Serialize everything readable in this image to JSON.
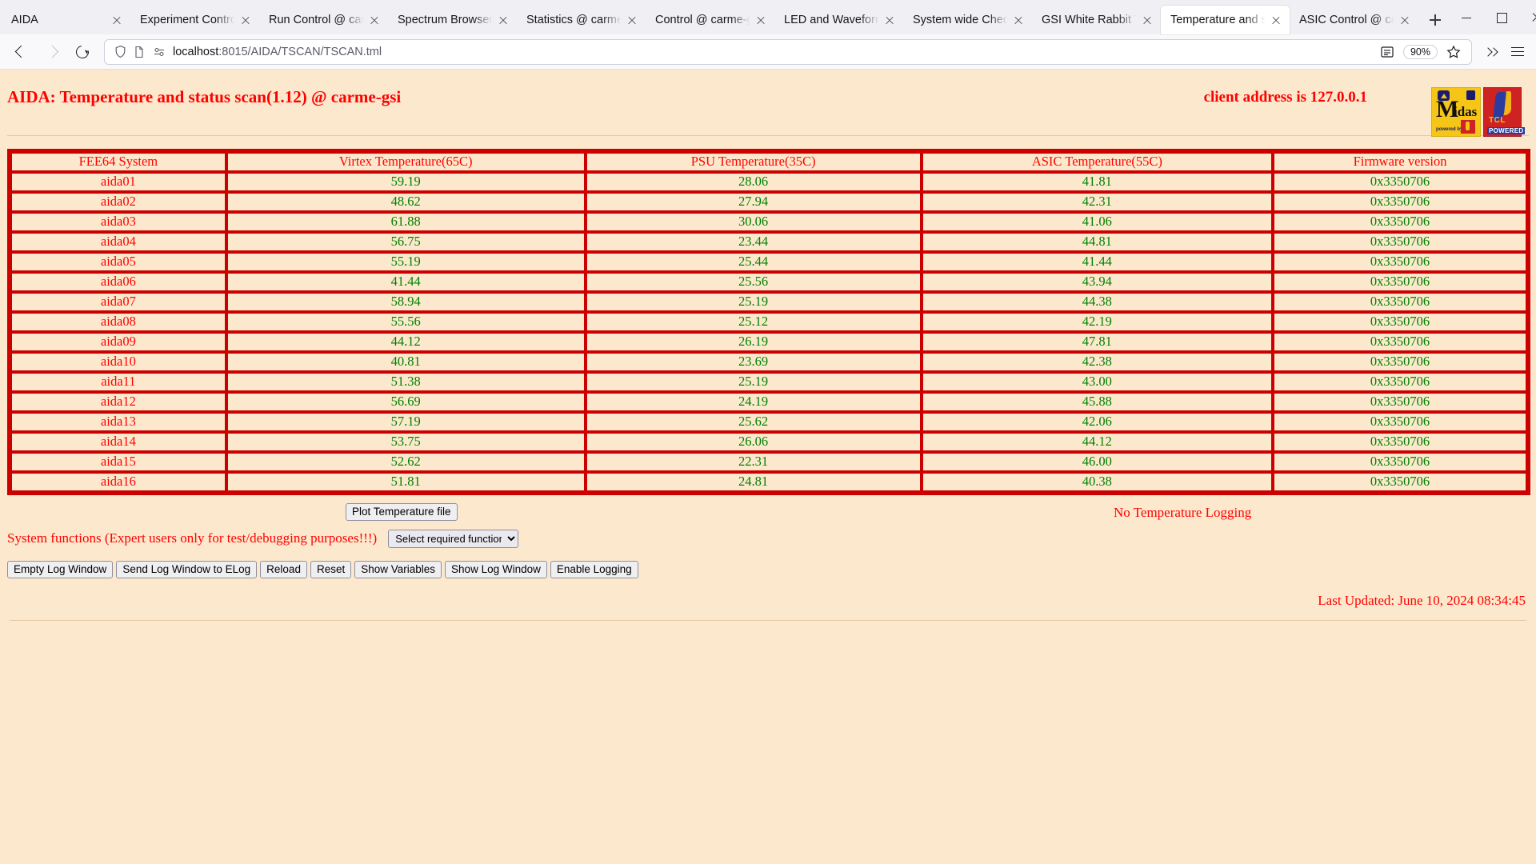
{
  "browser": {
    "tabs": [
      {
        "label": "AIDA",
        "active": false
      },
      {
        "label": "Experiment Control",
        "active": false
      },
      {
        "label": "Run Control @ carme",
        "active": false
      },
      {
        "label": "Spectrum Browser",
        "active": false
      },
      {
        "label": "Statistics @ carme",
        "active": false
      },
      {
        "label": "Control @ carme-gsi",
        "active": false
      },
      {
        "label": "LED and Waveform",
        "active": false
      },
      {
        "label": "System wide Check",
        "active": false
      },
      {
        "label": "GSI White Rabbit Ti",
        "active": false
      },
      {
        "label": "Temperature and st",
        "active": true
      },
      {
        "label": "ASIC Control @ car",
        "active": false
      }
    ],
    "new_tab_icon": "plus-icon",
    "window_controls": [
      "minimize-icon",
      "maximize-icon",
      "close-icon"
    ],
    "nav": {
      "back_icon": "arrow-left-icon",
      "forward_icon": "arrow-right-icon",
      "reload_icon": "reload-icon",
      "shield_icon": "shield-icon",
      "page_icon": "page-icon",
      "permissions_icon": "permissions-icon",
      "reader_icon": "reader-view-icon",
      "star_icon": "bookmark-star-icon",
      "overflow_icon": "chevron-double-right-icon",
      "menu_icon": "hamburger-menu-icon"
    },
    "url_host": "localhost",
    "url_path": ":8015/AIDA/TSCAN/TSCAN.tml",
    "zoom_level": "90%"
  },
  "page": {
    "title": "AIDA: Temperature and status scan(1.12) @ carme-gsi",
    "client_address": "client address is 127.0.0.1",
    "logos": {
      "midas": {
        "letter": "M",
        "rest": "idas",
        "powered_by": "powered by"
      },
      "tcl": {
        "name": "TCL",
        "powered": "POWERED"
      }
    },
    "table": {
      "columns": [
        "FEE64 System",
        "Virtex Temperature(65C)",
        "PSU Temperature(35C)",
        "ASIC Temperature(55C)",
        "Firmware version"
      ],
      "rows": [
        [
          "aida01",
          "59.19",
          "28.06",
          "41.81",
          "0x3350706"
        ],
        [
          "aida02",
          "48.62",
          "27.94",
          "42.31",
          "0x3350706"
        ],
        [
          "aida03",
          "61.88",
          "30.06",
          "41.06",
          "0x3350706"
        ],
        [
          "aida04",
          "56.75",
          "23.44",
          "44.81",
          "0x3350706"
        ],
        [
          "aida05",
          "55.19",
          "25.44",
          "41.44",
          "0x3350706"
        ],
        [
          "aida06",
          "41.44",
          "25.56",
          "43.94",
          "0x3350706"
        ],
        [
          "aida07",
          "58.94",
          "25.19",
          "44.38",
          "0x3350706"
        ],
        [
          "aida08",
          "55.56",
          "25.12",
          "42.19",
          "0x3350706"
        ],
        [
          "aida09",
          "44.12",
          "26.19",
          "47.81",
          "0x3350706"
        ],
        [
          "aida10",
          "40.81",
          "23.69",
          "42.38",
          "0x3350706"
        ],
        [
          "aida11",
          "51.38",
          "25.19",
          "43.00",
          "0x3350706"
        ],
        [
          "aida12",
          "56.69",
          "24.19",
          "45.88",
          "0x3350706"
        ],
        [
          "aida13",
          "57.19",
          "25.62",
          "42.06",
          "0x3350706"
        ],
        [
          "aida14",
          "53.75",
          "26.06",
          "44.12",
          "0x3350706"
        ],
        [
          "aida15",
          "52.62",
          "22.31",
          "46.00",
          "0x3350706"
        ],
        [
          "aida16",
          "51.81",
          "24.81",
          "40.38",
          "0x3350706"
        ]
      ]
    },
    "controls": {
      "plot_button": "Plot Temperature file",
      "logging_status": "No Temperature Logging",
      "system_functions_label": "System functions (Expert users only for test/debugging purposes!!!)",
      "function_select_value": "Select required function",
      "function_select_options": [
        "Select required function"
      ],
      "buttons": [
        "Empty Log Window",
        "Send Log Window to ELog",
        "Reload",
        "Reset",
        "Show Variables",
        "Show Log Window",
        "Enable Logging"
      ]
    },
    "last_updated": "Last Updated: June 10, 2024 08:34:45",
    "colors": {
      "background": "#fce9cd",
      "label_red": "#ff0000",
      "value_green": "#008000",
      "border_red": "#cc0000"
    }
  }
}
